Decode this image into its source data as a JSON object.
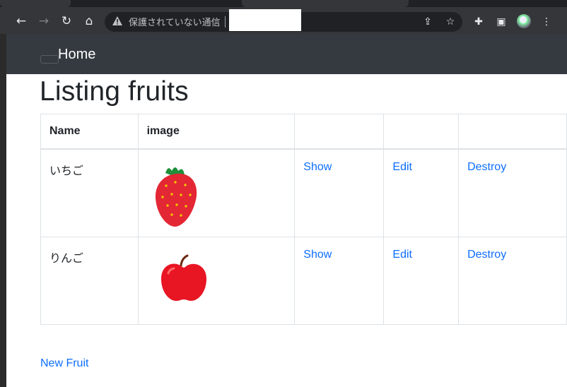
{
  "browser": {
    "security_text": "保護されていない通信"
  },
  "navbar": {
    "home_label": "Home"
  },
  "page": {
    "title": "Listing fruits",
    "table": {
      "headers": [
        "Name",
        "image",
        "",
        "",
        ""
      ],
      "rows": [
        {
          "name": "いちご",
          "image_icon": "strawberry-image",
          "show": "Show",
          "edit": "Edit",
          "destroy": "Destroy"
        },
        {
          "name": "りんご",
          "image_icon": "apple-image",
          "show": "Show",
          "edit": "Edit",
          "destroy": "Destroy"
        }
      ]
    },
    "new_link": "New Fruit"
  },
  "colors": {
    "navbar_bg": "#343a40",
    "link": "#0d6efd",
    "chrome_bg": "#35363a"
  }
}
